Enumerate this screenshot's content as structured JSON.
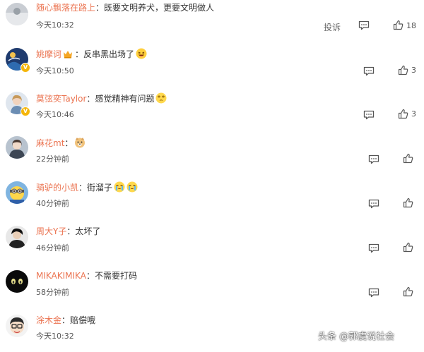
{
  "comments": [
    {
      "user": "随心飘落在路上",
      "sep": "：",
      "text": "既要文明养犬，更要文明做人",
      "time": "今天10:32",
      "report": "投诉",
      "likes": "18"
    },
    {
      "user": "姚摩诃",
      "sep": "：",
      "text": "反串黑出场了",
      "time": "今天10:50",
      "likes": "3"
    },
    {
      "user": "莫弦奕Taylor",
      "sep": "：",
      "text": "感觉精神有问题",
      "time": "今天10:46",
      "likes": "3"
    },
    {
      "user": "麻花mt",
      "sep": "：",
      "text": "",
      "time": "22分钟前",
      "likes": ""
    },
    {
      "user": "骑驴的小凯",
      "sep": "：",
      "text": "街溜子",
      "time": "40分钟前",
      "likes": ""
    },
    {
      "user": "周大Y子",
      "sep": "：",
      "text": "太坏了",
      "time": "46分钟前",
      "likes": ""
    },
    {
      "user": "MIKAKIMIKA",
      "sep": "：",
      "text": "不需要打码",
      "time": "58分钟前",
      "likes": ""
    },
    {
      "user": "涂木金",
      "sep": "：",
      "text": "赔偿哦",
      "time": "今天10:32",
      "likes": ""
    }
  ],
  "watermark": "头条 @郭虞说社会",
  "icons": {
    "reply": "comment-icon",
    "like": "thumbs-up-icon",
    "vip": "crown-icon",
    "verified": "verified-badge-icon"
  },
  "colors": {
    "username": "#eb7350",
    "verified": "#f5b60a",
    "text": "#333333"
  }
}
